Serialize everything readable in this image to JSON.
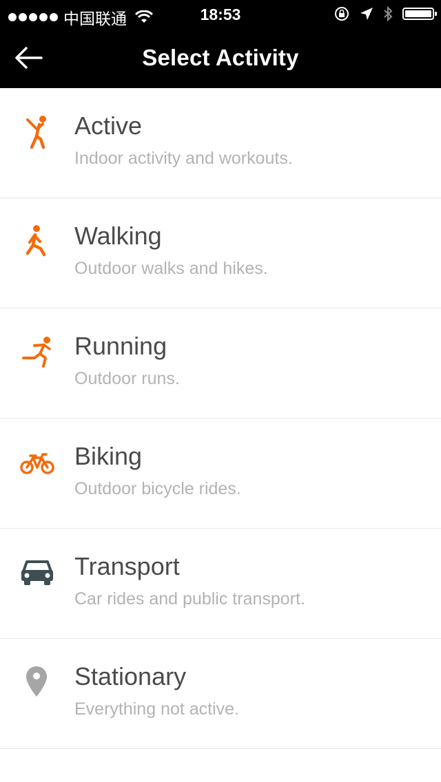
{
  "status_bar": {
    "carrier": "中国联通",
    "time": "18:53",
    "battery_level": 1.0
  },
  "header": {
    "title": "Select Activity",
    "back_icon": "back-arrow-icon"
  },
  "colors": {
    "accent": "#f26c0d",
    "transport": "#3f4e53",
    "stationary": "#a6a6a6"
  },
  "activities": [
    {
      "title": "Active",
      "description": "Indoor activity and workouts.",
      "icon": "active-icon"
    },
    {
      "title": "Walking",
      "description": "Outdoor walks and hikes.",
      "icon": "walking-icon"
    },
    {
      "title": "Running",
      "description": "Outdoor runs.",
      "icon": "running-icon"
    },
    {
      "title": "Biking",
      "description": "Outdoor bicycle rides.",
      "icon": "biking-icon"
    },
    {
      "title": "Transport",
      "description": "Car rides and public transport.",
      "icon": "car-icon"
    },
    {
      "title": "Stationary",
      "description": "Everything not active.",
      "icon": "location-pin-icon"
    }
  ]
}
